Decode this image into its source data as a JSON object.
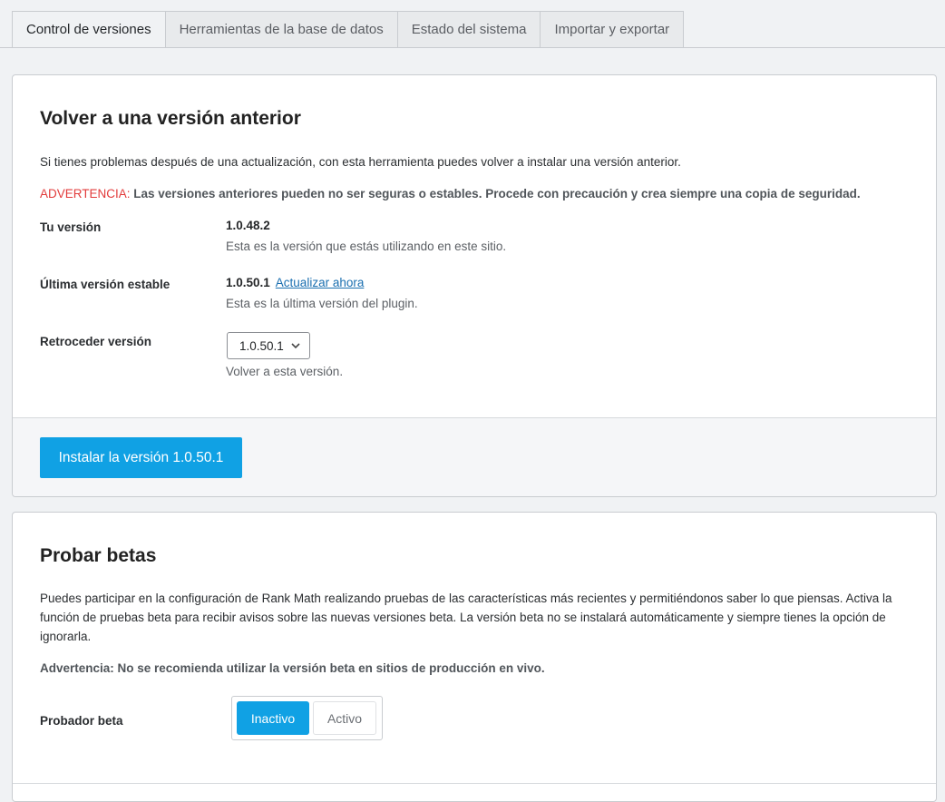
{
  "tabs": [
    {
      "label": "Control de versiones",
      "active": true
    },
    {
      "label": "Herramientas de la base de datos",
      "active": false
    },
    {
      "label": "Estado del sistema",
      "active": false
    },
    {
      "label": "Importar y exportar",
      "active": false
    }
  ],
  "rollback": {
    "title": "Volver a una versión anterior",
    "description": "Si tienes problemas después de una actualización, con esta herramienta puedes volver a instalar una versión anterior.",
    "warning_prefix": "ADVERTENCIA:",
    "warning_text": " Las versiones anteriores pueden no ser seguras o estables. Procede con precaución y crea siempre una copia de seguridad.",
    "your_version_label": "Tu versión",
    "your_version_value": "1.0.48.2",
    "your_version_desc": "Esta es la versión que estás utilizando en este sitio.",
    "latest_label": "Última versión estable",
    "latest_value": "1.0.50.1",
    "latest_link": "Actualizar ahora",
    "latest_desc": "Esta es la última versión del plugin.",
    "rollback_label": "Retroceder versión",
    "rollback_selected": "1.0.50.1",
    "rollback_desc": "Volver a esta versión.",
    "install_button": "Instalar la versión 1.0.50.1"
  },
  "beta": {
    "title": "Probar betas",
    "description_line1": "Puedes participar en la configuración de Rank Math realizando pruebas de las características más recientes y permitiéndonos saber lo que piensas. Activa la",
    "description_line2": "función de pruebas beta para recibir avisos sobre las nuevas versiones beta. La versión beta no se instalará automáticamente y siempre tienes la opción de",
    "description_line3": "ignorarla.",
    "warning": "Advertencia: No se recomienda utilizar la versión beta en sitios de producción en vivo.",
    "tester_label": "Probador beta",
    "option_off": "Inactivo",
    "option_on": "Activo"
  },
  "colors": {
    "accent": "#10a1e4",
    "warning": "#e23b3b",
    "link": "#1a6fb0"
  }
}
